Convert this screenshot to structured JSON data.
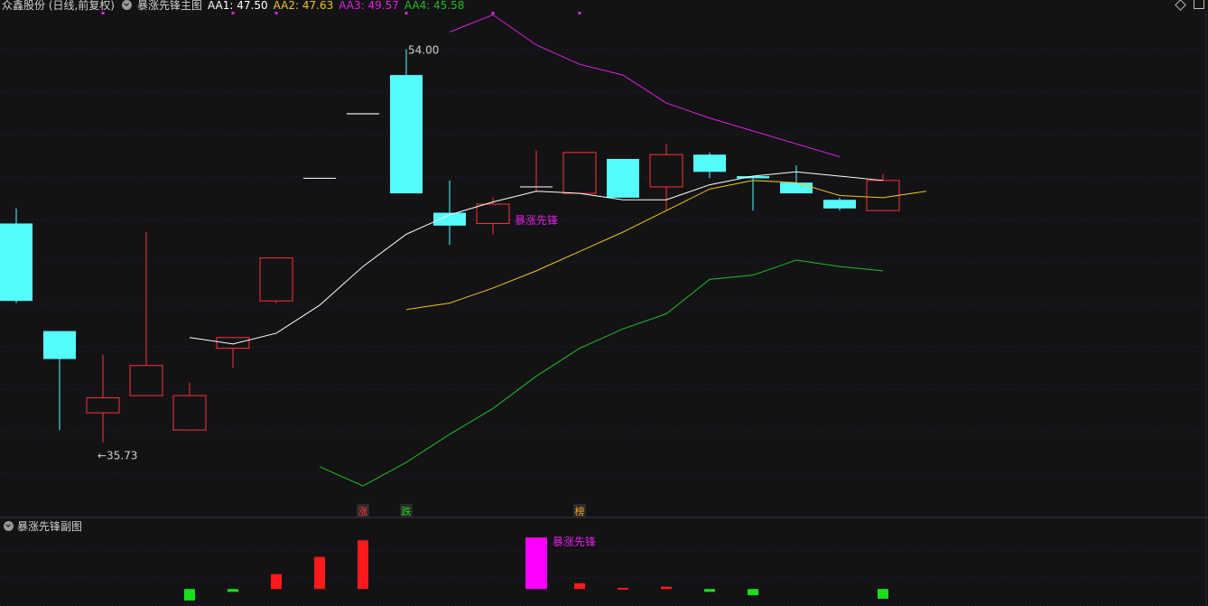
{
  "header": {
    "stock": "众鑫股份 (日线,前复权)",
    "indicator": "暴涨先锋主图",
    "aa1": "AA1: 47.50",
    "aa2": "AA2: 47.63",
    "aa3": "AA3: 49.57",
    "aa4": "AA4: 45.58"
  },
  "colors": {
    "bg": "#131316",
    "up": "#ff3232",
    "down": "#54fcfc",
    "aa1": "#ffffff",
    "aa2": "#f0c418",
    "aa3": "#e020e0",
    "aa4": "#1fbf1f",
    "sub_up": "#ff1a1a",
    "sub_down": "#18e018",
    "sub_special": "#ff00ff"
  },
  "sub_header": {
    "title": "暴涨先锋副图"
  },
  "chart_data": {
    "type": "candlestick",
    "ylim": [
      33.2,
      55.7
    ],
    "candles": [
      {
        "o": 45.9,
        "h": 46.6,
        "l": 42.2,
        "c": 42.3
      },
      {
        "o": 40.9,
        "h": 40.9,
        "l": 36.3,
        "c": 39.6
      },
      {
        "o": 37.1,
        "h": 39.8,
        "l": 35.73,
        "c": 37.8
      },
      {
        "o": 37.9,
        "h": 45.5,
        "l": 37.9,
        "c": 39.3
      },
      {
        "o": 36.3,
        "h": 38.5,
        "l": 36.3,
        "c": 37.9
      },
      {
        "o": 40.1,
        "h": 40.5,
        "l": 39.2,
        "c": 40.6
      },
      {
        "o": 42.3,
        "h": 42.3,
        "l": 42.2,
        "c": 44.3
      },
      {
        "o": 48.0,
        "h": 48.0,
        "l": 48.0,
        "c": 48.0
      },
      {
        "o": 51.0,
        "h": 51.0,
        "l": 51.0,
        "c": 51.0
      },
      {
        "o": 52.8,
        "h": 54.0,
        "l": 47.3,
        "c": 47.3
      },
      {
        "o": 46.4,
        "h": 47.9,
        "l": 44.9,
        "c": 45.8
      },
      {
        "o": 45.9,
        "h": 47.1,
        "l": 45.4,
        "c": 46.8
      },
      {
        "o": 47.6,
        "h": 49.3,
        "l": 47.4,
        "c": 47.6
      },
      {
        "o": 47.3,
        "h": 48.8,
        "l": 47.3,
        "c": 49.2
      },
      {
        "o": 48.9,
        "h": 48.9,
        "l": 47.1,
        "c": 47.1
      },
      {
        "o": 47.6,
        "h": 49.6,
        "l": 46.5,
        "c": 49.1
      },
      {
        "o": 49.1,
        "h": 49.2,
        "l": 48.0,
        "c": 48.3
      },
      {
        "o": 48.1,
        "h": 48.1,
        "l": 46.5,
        "c": 48.0
      },
      {
        "o": 47.8,
        "h": 48.6,
        "l": 47.3,
        "c": 47.3
      },
      {
        "o": 47.0,
        "h": 47.1,
        "l": 46.5,
        "c": 46.6
      },
      {
        "o": 46.5,
        "h": 48.2,
        "l": 46.5,
        "c": 47.9
      }
    ],
    "series": [
      {
        "name": "AA1",
        "start": 4,
        "values": [
          40.6,
          40.3,
          40.8,
          42.1,
          43.9,
          45.4,
          46.3,
          46.9,
          47.4,
          47.3,
          47.0,
          47.0,
          47.7,
          48.1,
          48.3,
          48.1,
          47.9
        ]
      },
      {
        "name": "AA2",
        "start": 9,
        "values": [
          41.9,
          42.2,
          42.9,
          43.7,
          44.6,
          45.5,
          46.5,
          47.5,
          47.9,
          47.8,
          47.2,
          47.1,
          47.4
        ]
      },
      {
        "name": "AA3",
        "start": 10,
        "values": [
          54.8,
          55.6,
          54.2,
          53.3,
          52.8,
          51.5,
          50.8,
          50.2,
          49.6,
          49.0
        ]
      },
      {
        "name": "AA4",
        "start": 7,
        "values": [
          34.6,
          33.7,
          34.8,
          36.1,
          37.3,
          38.8,
          40.1,
          41.0,
          41.7,
          43.3,
          43.5,
          44.2,
          43.9,
          43.7
        ]
      }
    ],
    "annotations": [
      {
        "idx": 2,
        "price": 35.73,
        "text": "←35.73",
        "side": "below"
      },
      {
        "idx": 9,
        "price": 54.0,
        "text": "54.00",
        "side": "above"
      },
      {
        "idx": 12,
        "price": 46.3,
        "text": "暴涨先锋",
        "side": "label"
      }
    ],
    "markers": [
      {
        "idx": 8,
        "text": "涨",
        "color": "#ff3030"
      },
      {
        "idx": 9,
        "text": "跌",
        "color": "#20d020"
      },
      {
        "idx": 13,
        "text": "榜",
        "color": "#f0a020"
      }
    ],
    "sub": {
      "bars": [
        {
          "idx": 4,
          "v": -2.0,
          "kind": "down"
        },
        {
          "idx": 5,
          "v": -0.5,
          "kind": "down"
        },
        {
          "idx": 6,
          "v": 2.6,
          "kind": "up"
        },
        {
          "idx": 7,
          "v": 5.6,
          "kind": "up"
        },
        {
          "idx": 8,
          "v": 8.5,
          "kind": "up"
        },
        {
          "idx": 12,
          "v": 9.0,
          "kind": "special"
        },
        {
          "idx": 13,
          "v": 1.0,
          "kind": "up"
        },
        {
          "idx": 14,
          "v": 0.2,
          "kind": "up"
        },
        {
          "idx": 15,
          "v": 0.4,
          "kind": "up"
        },
        {
          "idx": 16,
          "v": -0.5,
          "kind": "down"
        },
        {
          "idx": 17,
          "v": -1.1,
          "kind": "down"
        },
        {
          "idx": 20,
          "v": -1.7,
          "kind": "down"
        }
      ],
      "ylim": [
        -2.5,
        9.5
      ],
      "label": {
        "idx": 12,
        "text": "暴涨先锋"
      }
    }
  }
}
